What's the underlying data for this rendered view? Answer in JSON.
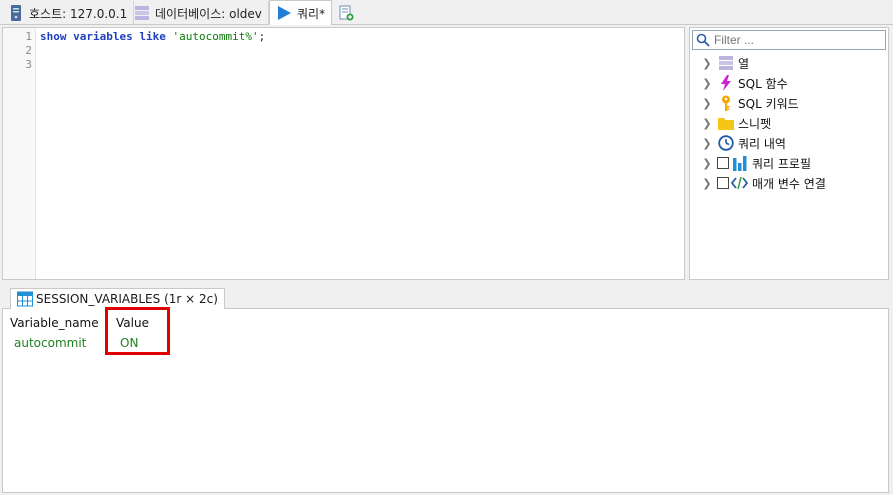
{
  "tabs": [
    {
      "label": "호스트: 127.0.0.1",
      "icon": "server-icon"
    },
    {
      "label": "데이터베이스: oldev",
      "icon": "database-icon"
    },
    {
      "label": "쿼리*",
      "icon": "play-icon"
    }
  ],
  "editor": {
    "line_numbers": [
      "1",
      "2",
      "3"
    ],
    "tokens": {
      "kw1": "show",
      "kw2": "variables",
      "kw3": "like",
      "str": "'autocommit%'",
      "end": ";"
    }
  },
  "side": {
    "filter_placeholder": "Filter ...",
    "items": [
      {
        "label": "열",
        "icon": "columns-icon",
        "checkbox": false
      },
      {
        "label": "SQL 함수",
        "icon": "lightning-icon",
        "checkbox": false
      },
      {
        "label": "SQL 키워드",
        "icon": "key-icon",
        "checkbox": false
      },
      {
        "label": "스니펫",
        "icon": "folder-icon",
        "checkbox": false
      },
      {
        "label": "쿼리 내역",
        "icon": "clock-icon",
        "checkbox": false
      },
      {
        "label": "쿼리 프로필",
        "icon": "bar-chart-icon",
        "checkbox": true
      },
      {
        "label": "매개 변수 연결",
        "icon": "code-icon",
        "checkbox": true
      }
    ]
  },
  "result": {
    "tab_label": "SESSION_VARIABLES (1r × 2c)",
    "columns": [
      "Variable_name",
      "Value"
    ],
    "rows": [
      [
        "autocommit",
        "ON"
      ]
    ]
  },
  "colors": {
    "highlight": "#e00000",
    "cell_text": "#208020",
    "keyword": "#1f3fbf",
    "string": "#0a7a0a"
  }
}
